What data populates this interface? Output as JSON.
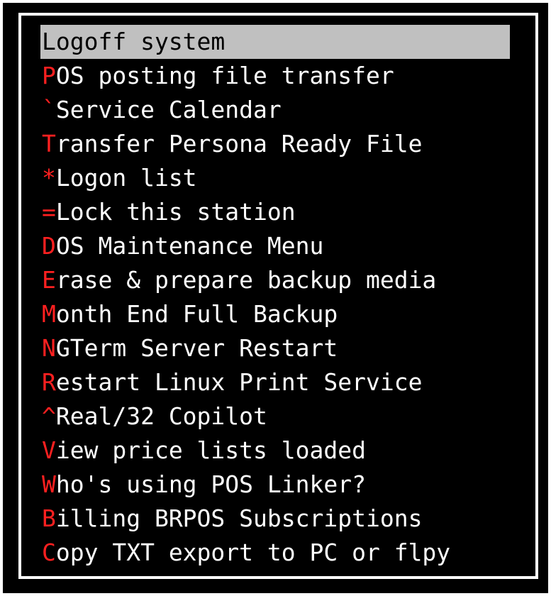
{
  "menu": {
    "selected_index": 0,
    "colors": {
      "background": "#000000",
      "text": "#ffffff",
      "hotkey": "#ff2020",
      "selection": "#c0c0c0",
      "border": "#ffffff"
    },
    "items": [
      {
        "hotkey": "L",
        "rest": "ogoff system"
      },
      {
        "hotkey": "P",
        "rest": "OS posting file transfer"
      },
      {
        "hotkey": "`",
        "rest": "Service Calendar"
      },
      {
        "hotkey": "T",
        "rest": "ransfer Persona Ready File"
      },
      {
        "hotkey": "*",
        "rest": "Logon list"
      },
      {
        "hotkey": "=",
        "rest": "Lock this station"
      },
      {
        "hotkey": "D",
        "rest": "OS Maintenance Menu"
      },
      {
        "hotkey": "E",
        "rest": "rase & prepare backup media"
      },
      {
        "hotkey": "M",
        "rest": "onth End Full Backup"
      },
      {
        "hotkey": "N",
        "rest": "GTerm Server Restart"
      },
      {
        "hotkey": "R",
        "rest": "estart Linux Print Service"
      },
      {
        "hotkey": "^",
        "rest": "Real/32 Copilot"
      },
      {
        "hotkey": "V",
        "rest": "iew price lists loaded"
      },
      {
        "hotkey": "W",
        "rest": "ho's using POS Linker?"
      },
      {
        "hotkey": "B",
        "rest": "illing BRPOS Subscriptions"
      },
      {
        "hotkey": "C",
        "rest": "opy TXT export to PC or flpy"
      }
    ]
  }
}
